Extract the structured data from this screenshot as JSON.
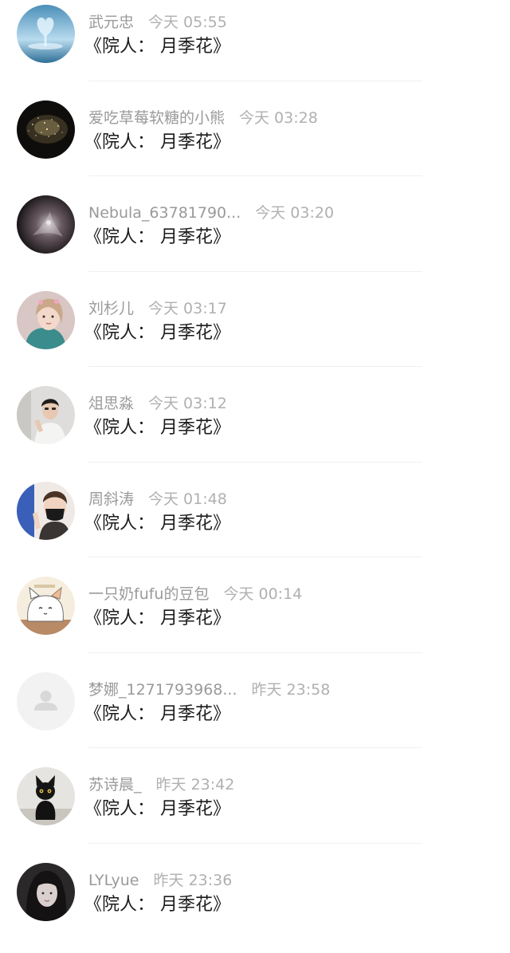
{
  "comment_text": "《院人： 月季花》",
  "comments": [
    {
      "user": "武元忠",
      "time": "今天 05:55",
      "avatar": "water-heart-avatar"
    },
    {
      "user": "爱吃草莓软糖的小熊",
      "time": "今天 03:28",
      "avatar": "dark-sparkle-avatar"
    },
    {
      "user": "Nebula_63781790...",
      "time": "今天 03:20",
      "avatar": "nebula-avatar"
    },
    {
      "user": "刘杉儿",
      "time": "今天 03:17",
      "avatar": "girl-selfie-avatar"
    },
    {
      "user": "俎思淼",
      "time": "今天 03:12",
      "avatar": "boy-photo-avatar"
    },
    {
      "user": "周斜涛",
      "time": "今天 01:48",
      "avatar": "masked-person-avatar"
    },
    {
      "user": "一只奶fufu的豆包",
      "time": "今天 00:14",
      "avatar": "cartoon-cat-avatar"
    },
    {
      "user": "梦娜_1271793968...",
      "time": "昨天 23:58",
      "avatar": "default-user-avatar"
    },
    {
      "user": "苏诗晨_",
      "time": "昨天 23:42",
      "avatar": "black-cat-avatar"
    },
    {
      "user": "LYLyue",
      "time": "昨天 23:36",
      "avatar": "dark-portrait-avatar"
    }
  ],
  "colors": {
    "username": "#9a9a9a",
    "time": "#b0b0b0",
    "comment": "#1c1c1c",
    "divider": "#f0f0f0"
  }
}
